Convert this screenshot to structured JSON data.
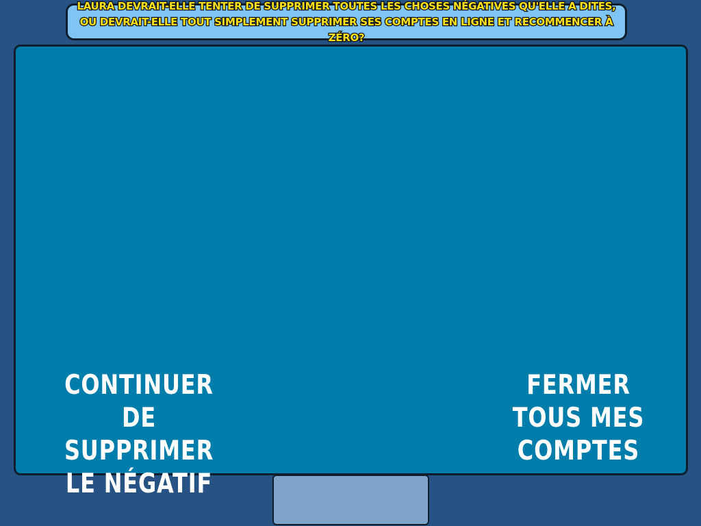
{
  "question": {
    "text": "Laura devrait-elle tenter de supprimer toutes les choses négatives qu'elle a dites, ou devrait-elle tout simplement supprimer ses comptes en ligne et recommencer à zéro?"
  },
  "choices": {
    "left_label": "Continuer de supprimer le négatif",
    "right_label": "Fermer tous mes comptes"
  },
  "colors": {
    "background": "#265384",
    "panel": "#007dab",
    "banner": "#7fc4f3",
    "banner_text": "#ffe11a",
    "tab": "#7ea5c9"
  }
}
